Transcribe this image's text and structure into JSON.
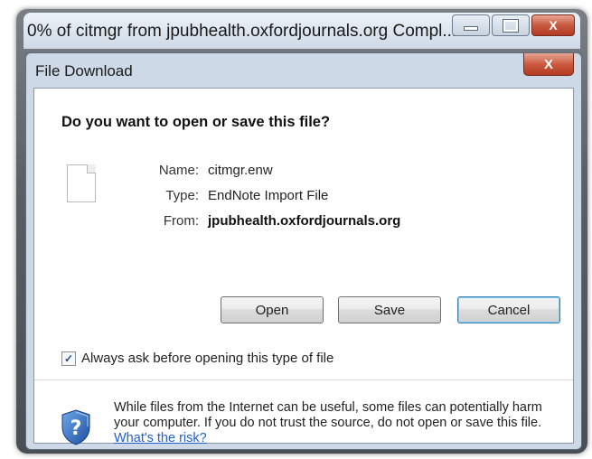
{
  "outer_window": {
    "title": "0% of citmgr from jpubhealth.oxfordjournals.org Compl...",
    "controls": {
      "close_glyph": "X"
    }
  },
  "dialog": {
    "title": "File Download",
    "close_glyph": "X",
    "question": "Do you want to open or save this file?",
    "file": {
      "icon": "file-icon",
      "name_label": "Name:",
      "name_value": "citmgr.enw",
      "type_label": "Type:",
      "type_value": "EndNote Import File",
      "from_label": "From:",
      "from_value": "jpubhealth.oxfordjournals.org"
    },
    "buttons": {
      "open": "Open",
      "save": "Save",
      "cancel": "Cancel"
    },
    "checkbox": {
      "checked": true,
      "label": "Always ask before opening this type of file"
    },
    "warning": {
      "icon": "shield-question-icon",
      "text": "While files from the Internet can be useful, some files can potentially harm your computer. If you do not trust the source, do not open or save this file.",
      "link": "What's the risk?"
    }
  },
  "colors": {
    "frame": "#5a5f66",
    "dialog_chrome": "#cdd9e6",
    "close_red": "#c85a3f",
    "link_blue": "#1f5fd1",
    "default_button_border": "#3c7fb1"
  }
}
